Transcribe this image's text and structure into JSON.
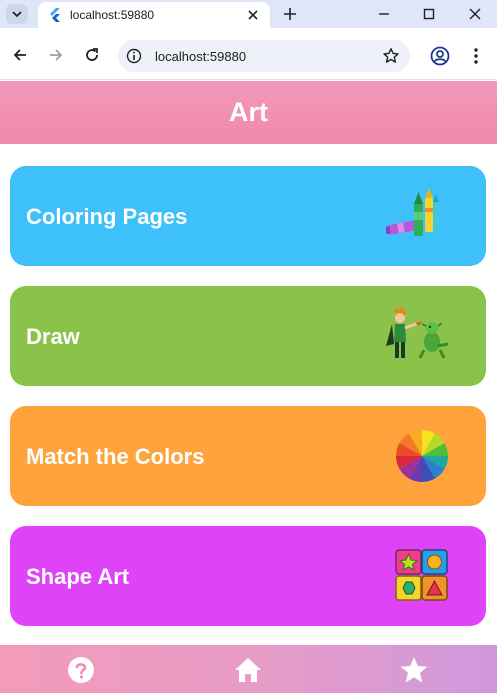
{
  "browser": {
    "tab_title": "localhost:59880",
    "url": "localhost:59880"
  },
  "app": {
    "title": "Art",
    "cards": [
      {
        "label": "Coloring Pages",
        "color": "#3ec1fb",
        "icon": "crayons-icon"
      },
      {
        "label": "Draw",
        "color": "#8bc34a",
        "icon": "hero-and-dragon-icon"
      },
      {
        "label": "Match the Colors",
        "color": "#ffa43d",
        "icon": "color-wheel-icon"
      },
      {
        "label": "Shape Art",
        "color": "#df43f7",
        "icon": "shape-blocks-icon"
      }
    ],
    "bottom_nav": [
      {
        "icon": "help-icon"
      },
      {
        "icon": "home-icon"
      },
      {
        "icon": "star-icon"
      }
    ],
    "colors": {
      "appbar": "#f08fb1",
      "bottombar_start": "#f39bba",
      "bottombar_end": "#cf98dc"
    }
  }
}
